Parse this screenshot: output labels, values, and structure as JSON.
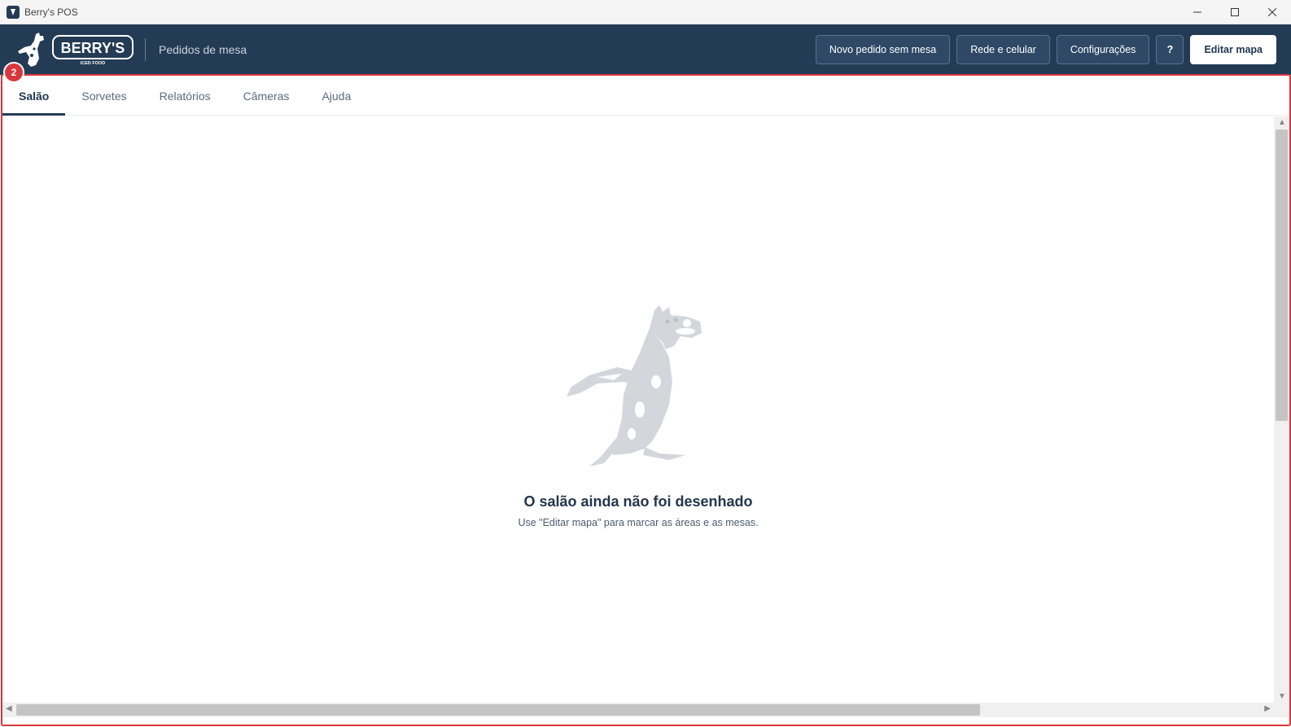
{
  "window": {
    "title": "Berry's POS",
    "icon": "app-icon",
    "controls": [
      "minimize-icon",
      "maximize-icon",
      "close-icon"
    ]
  },
  "header": {
    "brand_name": "BERRY'S",
    "brand_tagline": "ICED FOOD",
    "page_label": "Pedidos de mesa",
    "actions": {
      "new_order": "Novo pedido sem mesa",
      "network": "Rede e celular",
      "settings": "Configurações",
      "help": "?",
      "edit_map": "Editar mapa"
    }
  },
  "annotation": {
    "badge": "2",
    "color": "#d9373c"
  },
  "tabs": [
    {
      "label": "Salão",
      "active": true
    },
    {
      "label": "Sorvetes",
      "active": false
    },
    {
      "label": "Relatórios",
      "active": false
    },
    {
      "label": "Câmeras",
      "active": false
    },
    {
      "label": "Ajuda",
      "active": false
    }
  ],
  "empty_state": {
    "illustration": "cow-mascot-illustration",
    "title": "O salão ainda não foi desenhado",
    "subtitle": "Use \"Editar mapa\" para marcar as áreas e as mesas."
  },
  "colors": {
    "header_bg": "#243b55",
    "accent": "#243b55",
    "highlight": "#d9373c"
  }
}
